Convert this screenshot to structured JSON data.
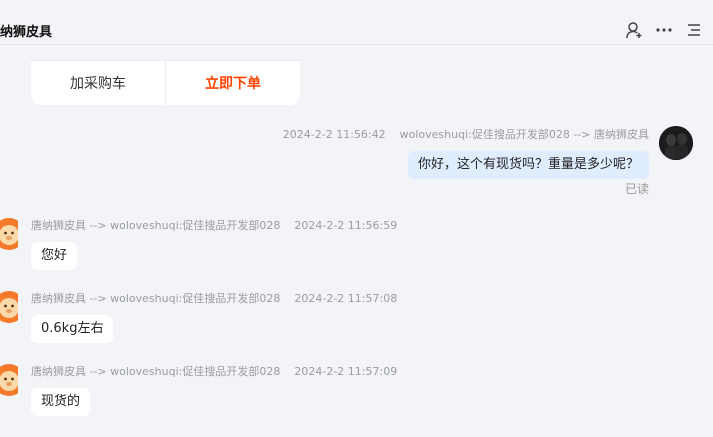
{
  "header": {
    "title": "纳狮皮具",
    "icons": [
      "person-icon",
      "more-icon",
      "menu-icon"
    ]
  },
  "card": {
    "add_to_cart": "加采购车",
    "buy_now": "立即下单",
    "buy_color": "#ff4400"
  },
  "messages": [
    {
      "side": "right",
      "time": "2024-2-2 11:56:42",
      "route": "woloveshuqi:促佳搜品开发部028 --> 唐纳狮皮具",
      "text": "你好，这个有现货吗？重量是多少呢？",
      "status": "已读"
    },
    {
      "side": "left",
      "route": "唐纳狮皮具 --> woloveshuqi:促佳搜品开发部028",
      "time": "2024-2-2 11:56:59",
      "text": "您好"
    },
    {
      "side": "left",
      "route": "唐纳狮皮具 --> woloveshuqi:促佳搜品开发部028",
      "time": "2024-2-2 11:57:08",
      "text": "0.6kg左右"
    },
    {
      "side": "left",
      "route": "唐纳狮皮具 --> woloveshuqi:促佳搜品开发部028",
      "time": "2024-2-2 11:57:09",
      "text": "现货的"
    }
  ]
}
